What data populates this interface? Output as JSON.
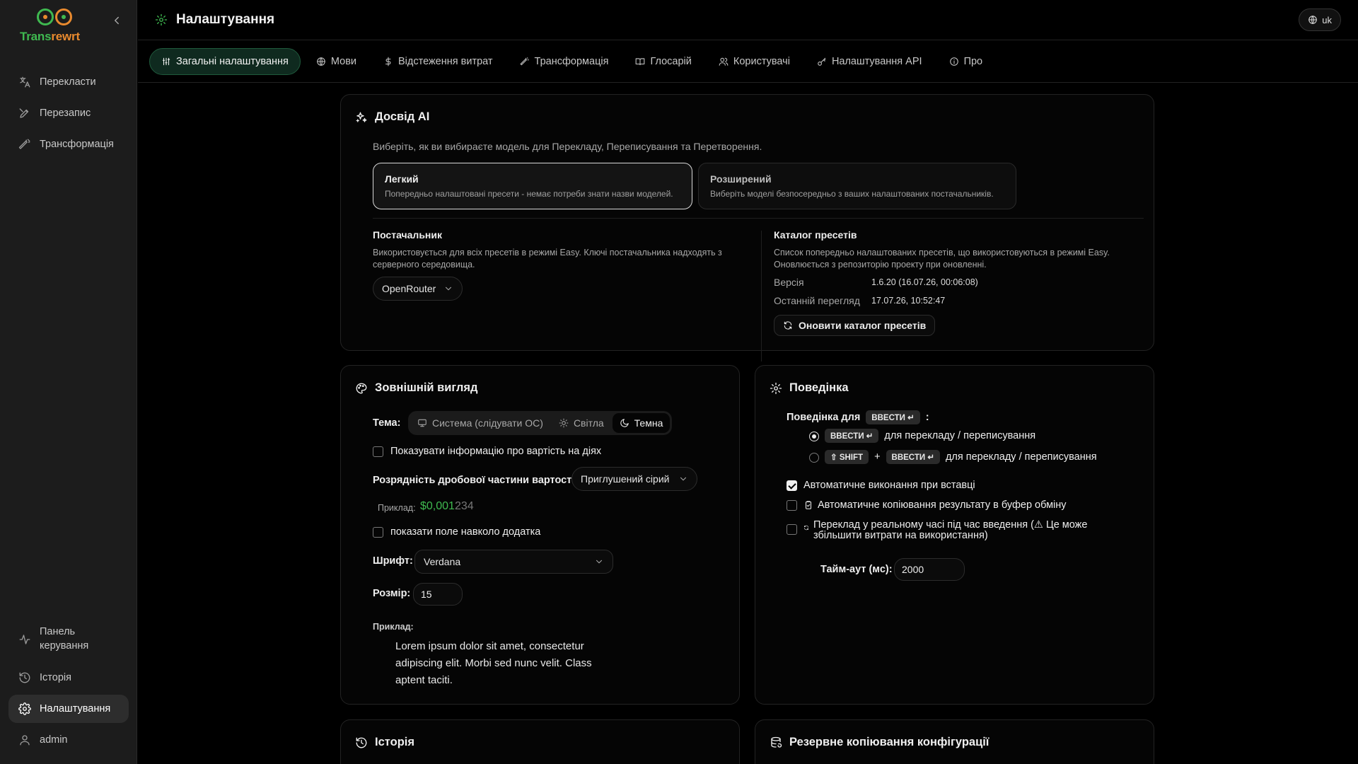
{
  "app": {
    "name_left": "Trans",
    "name_right": "rewrt"
  },
  "sidebar": {
    "items": [
      {
        "label": "Перекласти",
        "icon": "languages-icon"
      },
      {
        "label": "Перезапис",
        "icon": "pen-icon"
      },
      {
        "label": "Трансформація",
        "icon": "wand-icon"
      }
    ],
    "bottom": [
      {
        "label": "Панель\nкерування",
        "icon": "activity-icon"
      },
      {
        "label": "Історія",
        "icon": "history-icon"
      },
      {
        "label": "Налаштування",
        "icon": "gear-icon"
      },
      {
        "label": "admin",
        "icon": "user-icon"
      }
    ]
  },
  "header": {
    "title": "Налаштування",
    "lang": "uk"
  },
  "tabs": [
    {
      "label": "Загальні налаштування",
      "icon": "sliders-icon",
      "active": true
    },
    {
      "label": "Мови",
      "icon": "globe-icon"
    },
    {
      "label": "Відстеження витрат",
      "icon": "dollar-icon"
    },
    {
      "label": "Трансформація",
      "icon": "wand-icon"
    },
    {
      "label": "Глосарій",
      "icon": "book-icon"
    },
    {
      "label": "Користувачі",
      "icon": "users-icon"
    },
    {
      "label": "Налаштування API",
      "icon": "key-icon"
    },
    {
      "label": "Про",
      "icon": "info-icon"
    }
  ],
  "ai": {
    "title": "Досвід AI",
    "description": "Виберіть, як ви вибираєте модель для Перекладу, Переписування та Перетворення.",
    "easy": {
      "title": "Легкий",
      "desc": "Попередньо налаштовані пресети - немає потреби знати назви моделей."
    },
    "advanced": {
      "title": "Розширений",
      "desc": "Виберіть моделі безпосередньо з ваших налаштованих постачальників."
    },
    "provider": {
      "title": "Постачальник",
      "desc": "Використовується для всіх пресетів в режимі Easy. Ключі постачальника надходять з серверного середовища.",
      "value": "OpenRouter"
    },
    "catalog": {
      "title": "Каталог пресетів",
      "desc": "Список попередньо налаштованих пресетів, що використовуються в режимі Easy. Оновлюється з репозиторію проекту при оновленні.",
      "version_label": "Версія",
      "version_value": "1.6.20 (16.07.26, 00:06:08)",
      "last_label": "Останній перегляд",
      "last_value": "17.07.26, 10:52:47",
      "refresh": "Оновити каталог пресетів"
    }
  },
  "appearance": {
    "title": "Зовнішній вигляд",
    "theme_label": "Тема:",
    "theme_options": [
      "Система (слідувати ОС)",
      "Світла",
      "Темна"
    ],
    "show_cost": "Показувати інформацію про вартість на діях",
    "precision_label": "Розрядність дробової частини вартості:",
    "precision_value": "Приглушений сірий",
    "example_label": "Приклад:",
    "example_bright": "$0,001",
    "example_dim": "234",
    "show_border": "показати поле навколо додатка",
    "font_label": "Шрифт:",
    "font_value": "Verdana",
    "size_label": "Розмір:",
    "size_value": "15",
    "preview_label": "Приклад:",
    "preview_text": "Lorem ipsum dolor sit amet, consectetur adipiscing elit. Morbi sed nunc velit. Class aptent taciti."
  },
  "behavior": {
    "title": "Поведінка",
    "behavior_for": "Поведінка для",
    "enter_key": "ВВЕСТИ ↵",
    "colon": ":",
    "opt1_suffix": "для перекладу / переписування",
    "shift_key": "⇧ SHIFT",
    "plus": "+",
    "opt2_suffix": "для перекладу / переписування",
    "auto_run": "Автоматичне виконання при вставці",
    "auto_copy": "Автоматичне копіювання результату в буфер обміну",
    "realtime": "Переклад у реальному часі під час введення (⚠ Це може збільшити витрати на використання)",
    "timeout_label": "Тайм-аут (мс):",
    "timeout_value": "2000"
  },
  "history_card": {
    "title": "Історія"
  },
  "backup_card": {
    "title": "Резервне копіювання конфігурації"
  },
  "colors": {
    "accent": "#3fb950",
    "brand_orange": "#e98a2e",
    "active_tab_bg": "#0f2a1f"
  }
}
